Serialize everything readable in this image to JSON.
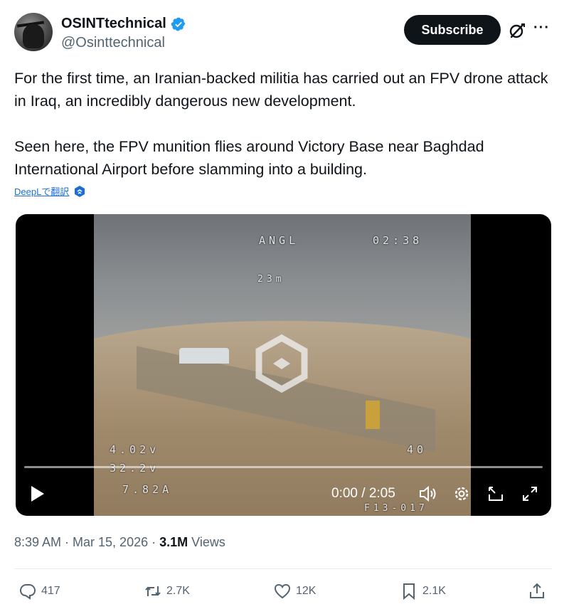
{
  "author": {
    "name": "OSINTtechnical",
    "handle": "@Osinttechnical",
    "verified_icon": "verified-badge-icon"
  },
  "header": {
    "subscribe_label": "Subscribe",
    "grok_icon": "grok-icon",
    "more_label": "···"
  },
  "tweet": {
    "paragraph_1": "For the first time, an Iranian-backed militia has carried out an FPV drone attack in Iraq, an incredibly dangerous new development.",
    "paragraph_2": "Seen here, the FPV munition flies around Victory Base near Baghdad International Airport before slamming into a building.",
    "translate_label": "DeepLで翻訳"
  },
  "video": {
    "osd": {
      "mode": "ANGL",
      "timer": "02:38",
      "altitude": "23m",
      "voltage_cell": "4.02v",
      "voltage_total": "32.2v",
      "current": "7.82A",
      "speed": "40",
      "footer": "F13-017"
    },
    "time_label": "0:00 / 2:05",
    "progress": 0.0,
    "icons": [
      "play-icon",
      "volume-icon",
      "settings-icon",
      "pip-icon",
      "fullscreen-icon"
    ]
  },
  "meta": {
    "timestamp": "8:39 AM · Mar 15, 2026 · ",
    "views_count": "3.1M",
    "views_label": " Views"
  },
  "actions": {
    "replies": "417",
    "reposts": "2.7K",
    "likes": "12K",
    "bookmarks": "2.1K"
  },
  "colors": {
    "text": "#0f1419",
    "secondary": "#536471",
    "verified": "#1d9bf0",
    "link": "#1d6fd8"
  }
}
